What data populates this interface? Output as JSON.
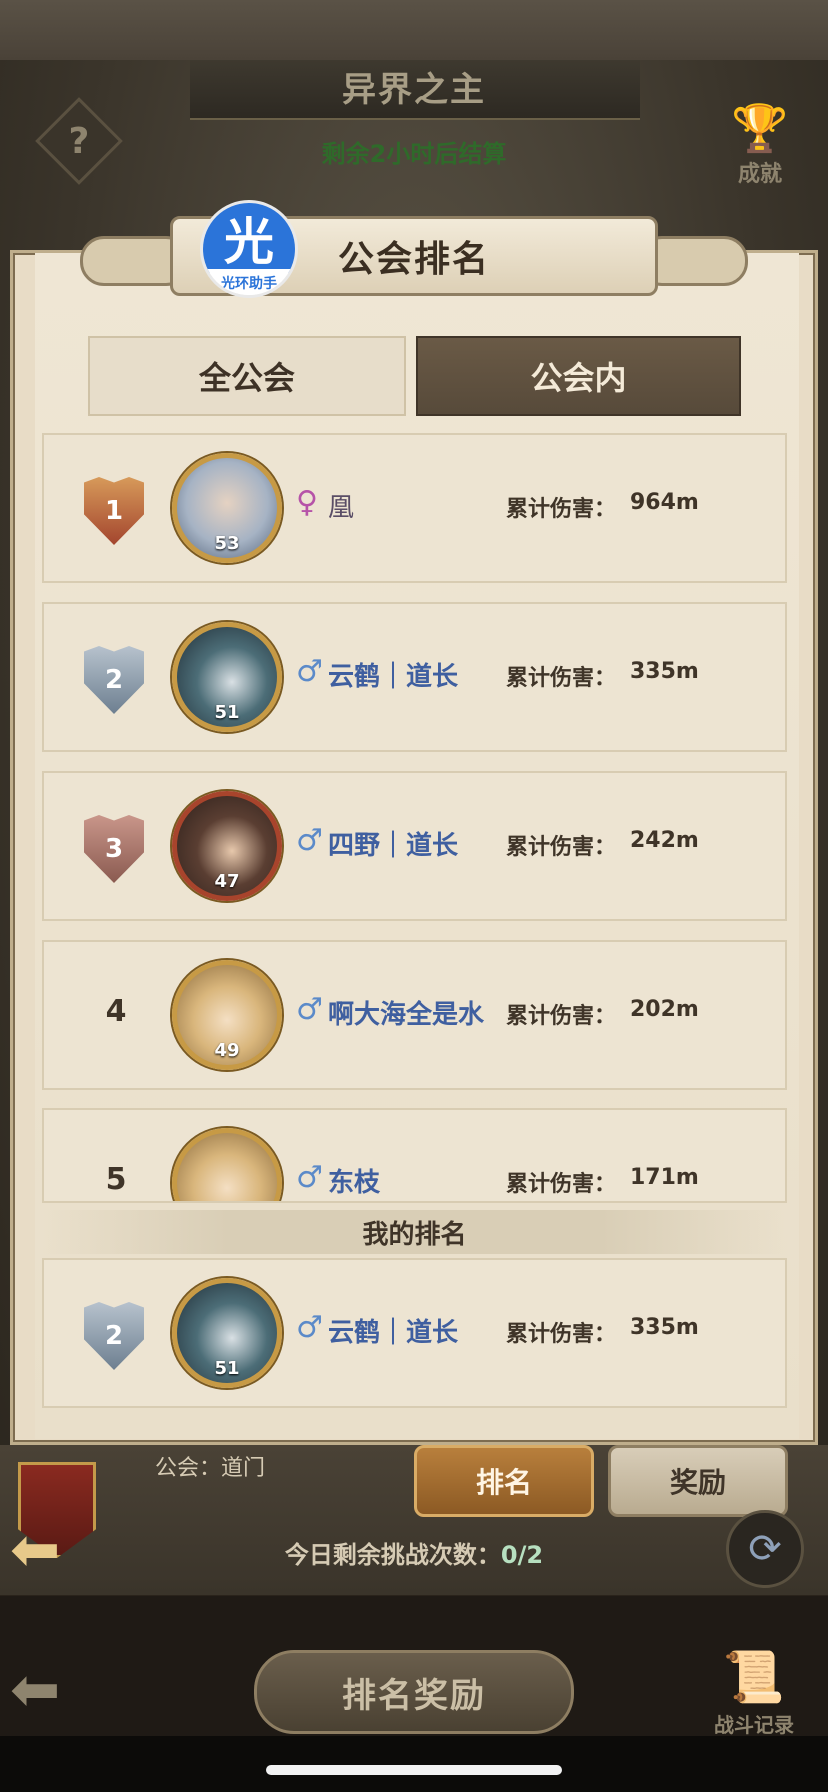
{
  "background": {
    "title": "异界之主",
    "timer": "剩余2小时后结算",
    "help_icon_glyph": "?",
    "achievement_label": "成就"
  },
  "badge": {
    "char": "光",
    "label": "光环助手"
  },
  "modal": {
    "title": "公会排名",
    "tabs": [
      {
        "label": "全公会",
        "active": false
      },
      {
        "label": "公会内",
        "active": true
      }
    ],
    "damage_label": "累计伤害：",
    "rows": [
      {
        "rank": "1",
        "level": "53",
        "gender": "♀",
        "name": "凰",
        "damage": "964m"
      },
      {
        "rank": "2",
        "level": "51",
        "gender": "♂",
        "name": "云鹤｜道长",
        "damage": "335m"
      },
      {
        "rank": "3",
        "level": "47",
        "gender": "♂",
        "name": "四野｜道长",
        "damage": "242m"
      },
      {
        "rank": "4",
        "level": "49",
        "gender": "♂",
        "name": "啊大海全是水",
        "damage": "202m"
      },
      {
        "rank": "5",
        "level": "",
        "gender": "♂",
        "name": "东枝",
        "damage": "171m"
      }
    ],
    "my_rank_title": "我的排名",
    "my_rank": {
      "rank": "2",
      "level": "51",
      "gender": "♂",
      "name": "云鹤｜道长",
      "damage": "335m"
    }
  },
  "lower": {
    "guild": "公会：道门",
    "rank_button": "排名",
    "reward_button": "奖励",
    "remaining_label": "今日剩余挑战次数：",
    "remaining_count": "0/2",
    "refresh_glyph": "⟳"
  },
  "footer": {
    "rank_reward_button": "排名奖励",
    "battle_log_label": "战斗记录"
  },
  "colors": {
    "panel_bg": "#e8dcc6",
    "active_tab": "#5f5040",
    "male_color": "#5b8ac9",
    "female_color": "#b653a8",
    "badge_blue": "#2b74d9"
  }
}
